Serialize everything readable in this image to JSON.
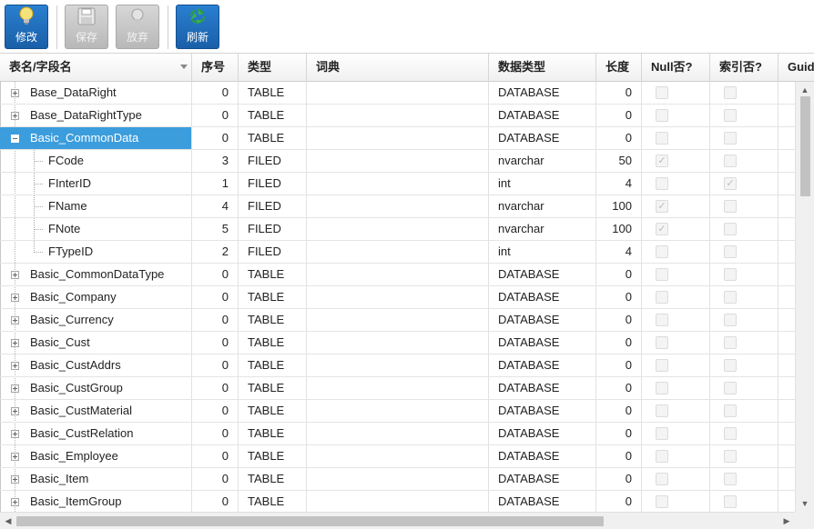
{
  "toolbar": {
    "buttons": [
      {
        "label": "修改",
        "icon": "edit-bulb-icon",
        "state": "active"
      },
      {
        "label": "保存",
        "icon": "save-floppy-icon",
        "state": "disabled"
      },
      {
        "label": "放弃",
        "icon": "discard-icon",
        "state": "disabled"
      },
      {
        "label": "刷新",
        "icon": "refresh-recycle-icon",
        "state": "active"
      }
    ]
  },
  "grid": {
    "columns": [
      "表名/字段名",
      "序号",
      "类型",
      "词典",
      "数据类型",
      "长度",
      "Null否?",
      "索引否?",
      "Guid"
    ],
    "rows": [
      {
        "name": "Base_DataRight",
        "seq": "0",
        "type": "TABLE",
        "dict": "",
        "dtype": "DATABASE",
        "len": "0",
        "nullable": false,
        "indexed": false,
        "level": 0,
        "expander": "plus"
      },
      {
        "name": "Base_DataRightType",
        "seq": "0",
        "type": "TABLE",
        "dict": "",
        "dtype": "DATABASE",
        "len": "0",
        "nullable": false,
        "indexed": false,
        "level": 0,
        "expander": "plus"
      },
      {
        "name": "Basic_CommonData",
        "seq": "0",
        "type": "TABLE",
        "dict": "",
        "dtype": "DATABASE",
        "len": "0",
        "nullable": false,
        "indexed": false,
        "level": 0,
        "expander": "minus",
        "selected": true
      },
      {
        "name": "FCode",
        "seq": "3",
        "type": "FILED",
        "dict": "",
        "dtype": "nvarchar",
        "len": "50",
        "nullable": true,
        "indexed": false,
        "level": 1
      },
      {
        "name": "FInterID",
        "seq": "1",
        "type": "FILED",
        "dict": "",
        "dtype": "int",
        "len": "4",
        "nullable": false,
        "indexed": true,
        "level": 1
      },
      {
        "name": "FName",
        "seq": "4",
        "type": "FILED",
        "dict": "",
        "dtype": "nvarchar",
        "len": "100",
        "nullable": true,
        "indexed": false,
        "level": 1
      },
      {
        "name": "FNote",
        "seq": "5",
        "type": "FILED",
        "dict": "",
        "dtype": "nvarchar",
        "len": "100",
        "nullable": true,
        "indexed": false,
        "level": 1
      },
      {
        "name": "FTypeID",
        "seq": "2",
        "type": "FILED",
        "dict": "",
        "dtype": "int",
        "len": "4",
        "nullable": false,
        "indexed": false,
        "level": 1,
        "last": true
      },
      {
        "name": "Basic_CommonDataType",
        "seq": "0",
        "type": "TABLE",
        "dict": "",
        "dtype": "DATABASE",
        "len": "0",
        "nullable": false,
        "indexed": false,
        "level": 0,
        "expander": "plus"
      },
      {
        "name": "Basic_Company",
        "seq": "0",
        "type": "TABLE",
        "dict": "",
        "dtype": "DATABASE",
        "len": "0",
        "nullable": false,
        "indexed": false,
        "level": 0,
        "expander": "plus"
      },
      {
        "name": "Basic_Currency",
        "seq": "0",
        "type": "TABLE",
        "dict": "",
        "dtype": "DATABASE",
        "len": "0",
        "nullable": false,
        "indexed": false,
        "level": 0,
        "expander": "plus"
      },
      {
        "name": "Basic_Cust",
        "seq": "0",
        "type": "TABLE",
        "dict": "",
        "dtype": "DATABASE",
        "len": "0",
        "nullable": false,
        "indexed": false,
        "level": 0,
        "expander": "plus"
      },
      {
        "name": "Basic_CustAddrs",
        "seq": "0",
        "type": "TABLE",
        "dict": "",
        "dtype": "DATABASE",
        "len": "0",
        "nullable": false,
        "indexed": false,
        "level": 0,
        "expander": "plus"
      },
      {
        "name": "Basic_CustGroup",
        "seq": "0",
        "type": "TABLE",
        "dict": "",
        "dtype": "DATABASE",
        "len": "0",
        "nullable": false,
        "indexed": false,
        "level": 0,
        "expander": "plus"
      },
      {
        "name": "Basic_CustMaterial",
        "seq": "0",
        "type": "TABLE",
        "dict": "",
        "dtype": "DATABASE",
        "len": "0",
        "nullable": false,
        "indexed": false,
        "level": 0,
        "expander": "plus"
      },
      {
        "name": "Basic_CustRelation",
        "seq": "0",
        "type": "TABLE",
        "dict": "",
        "dtype": "DATABASE",
        "len": "0",
        "nullable": false,
        "indexed": false,
        "level": 0,
        "expander": "plus"
      },
      {
        "name": "Basic_Employee",
        "seq": "0",
        "type": "TABLE",
        "dict": "",
        "dtype": "DATABASE",
        "len": "0",
        "nullable": false,
        "indexed": false,
        "level": 0,
        "expander": "plus"
      },
      {
        "name": "Basic_Item",
        "seq": "0",
        "type": "TABLE",
        "dict": "",
        "dtype": "DATABASE",
        "len": "0",
        "nullable": false,
        "indexed": false,
        "level": 0,
        "expander": "plus"
      },
      {
        "name": "Basic_ItemGroup",
        "seq": "0",
        "type": "TABLE",
        "dict": "",
        "dtype": "DATABASE",
        "len": "0",
        "nullable": false,
        "indexed": false,
        "level": 0,
        "expander": "plus"
      }
    ]
  },
  "colors": {
    "accent": "#1a5fa8",
    "selection": "#3c9ddd"
  }
}
